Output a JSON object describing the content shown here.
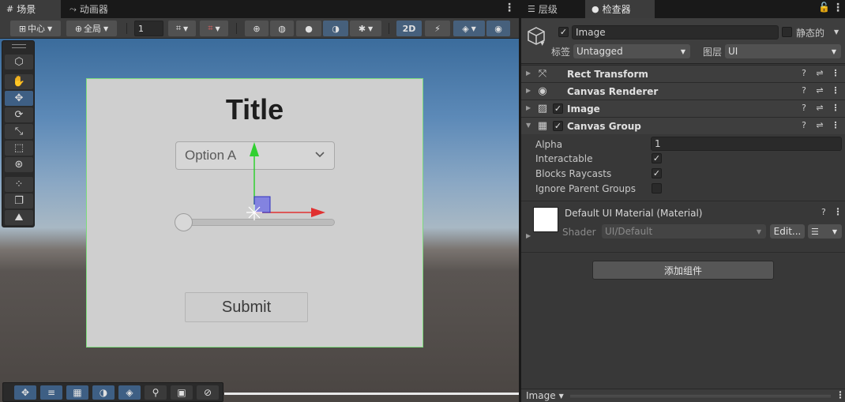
{
  "scene": {
    "tabs": [
      {
        "label": "场景",
        "icon": "grid-icon"
      },
      {
        "label": "动画器",
        "icon": "animator-icon"
      }
    ],
    "toolbar": {
      "pivot_label": "中心",
      "space_label": "全局",
      "grid_value": "1",
      "mode_2d_label": "2D"
    },
    "canvas": {
      "title": "Title",
      "dropdown_value": "Option A",
      "slider_value": 0,
      "submit_label": "Submit"
    }
  },
  "inspector": {
    "tabs": [
      {
        "label": "层级",
        "icon": "hierarchy-icon"
      },
      {
        "label": "检查器",
        "icon": "info-icon"
      }
    ],
    "object": {
      "name": "Image",
      "active": true,
      "static_label": "静态的",
      "static": false,
      "tag_label": "标签",
      "tag_value": "Untagged",
      "layer_label": "图层",
      "layer_value": "UI"
    },
    "components": [
      {
        "name": "Rect Transform",
        "icon": "rect-transform-icon",
        "has_toggle": false
      },
      {
        "name": "Canvas Renderer",
        "icon": "eye-icon",
        "has_toggle": false
      },
      {
        "name": "Image",
        "icon": "image-icon",
        "has_toggle": true,
        "enabled": true
      },
      {
        "name": "Canvas Group",
        "icon": "canvas-group-icon",
        "has_toggle": true,
        "enabled": true,
        "expanded": true
      }
    ],
    "canvas_group": {
      "alpha_label": "Alpha",
      "alpha_value": "1",
      "interactable_label": "Interactable",
      "interactable": true,
      "blocks_raycasts_label": "Blocks Raycasts",
      "blocks_raycasts": true,
      "ignore_parent_label": "Ignore Parent Groups",
      "ignore_parent": false
    },
    "material": {
      "name": "Default UI Material (Material)",
      "shader_label": "Shader",
      "shader_value": "UI/Default",
      "edit_label": "Edit..."
    },
    "add_component_label": "添加组件",
    "footer_label": "Image"
  },
  "colors": {
    "accent_blue": "#46607c",
    "canvas_border": "#7ddc7d",
    "gizmo_x": "#e03030",
    "gizmo_y": "#30d030"
  }
}
